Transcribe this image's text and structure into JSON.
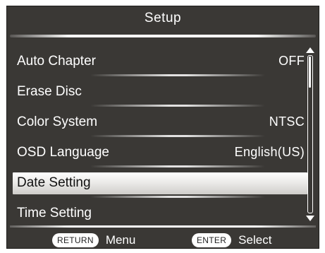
{
  "header": {
    "title": "Setup"
  },
  "menu": {
    "items": [
      {
        "label": "Auto Chapter",
        "value": "OFF"
      },
      {
        "label": "Erase Disc",
        "value": ""
      },
      {
        "label": "Color System",
        "value": "NTSC"
      },
      {
        "label": "OSD Language",
        "value": "English(US)"
      },
      {
        "label": "Date Setting",
        "value": ""
      },
      {
        "label": "Time Setting",
        "value": ""
      }
    ],
    "selected_index": 4
  },
  "footer": {
    "return_key": "RETURN",
    "return_action": "Menu",
    "enter_key": "ENTER",
    "enter_action": "Select"
  },
  "icons": {
    "scroll_up": "arrow-up-icon",
    "scroll_down": "arrow-down-icon"
  },
  "colors": {
    "background": "#3a3835",
    "text": "#ffffff",
    "selected_row": "#e9e8e6"
  }
}
